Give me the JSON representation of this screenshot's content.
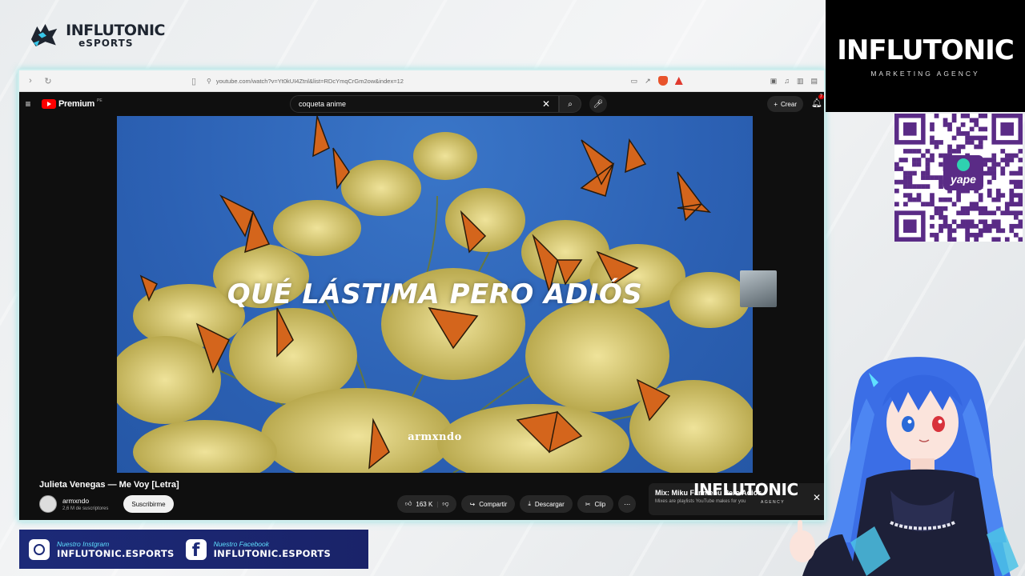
{
  "brand": {
    "line1": "INFLUTONIC",
    "line2": "eSPORTS"
  },
  "agency": {
    "title": "INFLUTONIC",
    "subtitle": "MARKETING AGENCY"
  },
  "browser": {
    "url": "youtube.com/watch?v=Yt0kUI4Ztnl&list=RDcYmqCrGm2ow&index=12"
  },
  "youtube": {
    "brand": "Premium",
    "region": "PE",
    "search_value": "coqueta anime",
    "create_label": "Crear",
    "notifications": "7"
  },
  "video": {
    "lyric": "QUÉ LÁSTIMA PERO ADIÓS",
    "watermark": "armxndo",
    "title": "Julieta Venegas — Me Voy [Letra]"
  },
  "channel": {
    "name": "armxndo",
    "subscribers": "2,6 M de suscriptores",
    "subscribe_label": "Suscribirme"
  },
  "actions": {
    "likes": "163 K",
    "share": "Compartir",
    "download": "Descargar",
    "clip": "Clip"
  },
  "mix": {
    "title": "Mix: Miku Fanmenu Pero Adiós",
    "subtitle": "Mixes are playlists YouTube makes for you",
    "overlay_title": "INFLUTONIC",
    "overlay_sub": "AGENCY"
  },
  "social": {
    "instagram_small": "Nuestro Instgram",
    "instagram_handle": "INFLUTONIC.ESPORTS",
    "facebook_small": "Nuestro Facebook",
    "facebook_handle": "INFLUTONIC.ESPORTS"
  },
  "qr": {
    "label": "yape"
  },
  "colors": {
    "sky": "#2c61b4",
    "accent_cyan": "#5fe0ff",
    "social_bg": "#1c2a78",
    "yape": "#5a2b86"
  }
}
